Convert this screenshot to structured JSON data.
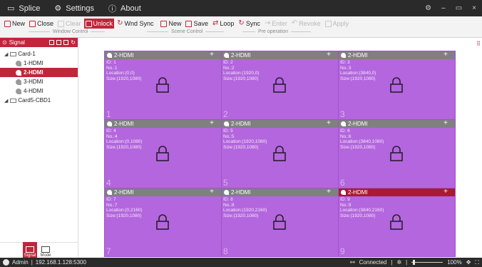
{
  "titlebar": {
    "tabs": [
      {
        "label": "Splice",
        "icon": "window-icon"
      },
      {
        "label": "Settings",
        "icon": "gear-icon"
      },
      {
        "label": "About",
        "icon": "info-icon"
      }
    ],
    "controls": {
      "settings": "⚙",
      "minimize": "–",
      "restore": "▭",
      "close": "×"
    }
  },
  "toolbar": {
    "window_control": {
      "label": "Window Control",
      "buttons": [
        {
          "label": "New",
          "state": "normal"
        },
        {
          "label": "Close",
          "state": "normal"
        },
        {
          "label": "Clear",
          "state": "disabled"
        },
        {
          "label": "Unlock",
          "state": "active"
        },
        {
          "label": "Wnd Sync",
          "state": "normal"
        }
      ]
    },
    "scene_control": {
      "label": "Scene Control",
      "buttons": [
        {
          "label": "New",
          "state": "normal"
        },
        {
          "label": "Save",
          "state": "normal"
        },
        {
          "label": "Loop",
          "state": "normal"
        },
        {
          "label": "Sync",
          "state": "normal"
        }
      ]
    },
    "pre_operation": {
      "label": "Pre operation",
      "buttons": [
        {
          "label": "Enter",
          "state": "disabled"
        },
        {
          "label": "Revoke",
          "state": "disabled"
        },
        {
          "label": "Apply",
          "state": "disabled"
        }
      ]
    }
  },
  "left_panel": {
    "header": "Signal",
    "tree": [
      {
        "label": "Card-1",
        "level": 0,
        "type": "card"
      },
      {
        "label": "1-HDMI",
        "level": 1,
        "type": "hdmi"
      },
      {
        "label": "2-HDMI",
        "level": 1,
        "type": "hdmi",
        "selected": true
      },
      {
        "label": "3-HDMI",
        "level": 1,
        "type": "hdmi"
      },
      {
        "label": "4-HDMI",
        "level": 1,
        "type": "hdmi"
      },
      {
        "label": "Card5-CBD1",
        "level": 0,
        "type": "card"
      }
    ],
    "modes": {
      "signal": "Signal",
      "mode": "Mode"
    }
  },
  "screens": [
    {
      "title": "2-HDMI",
      "id": "ID: 1",
      "no": "No.:1",
      "location": "Location:(0,0)",
      "size": "Size:(1920,1080)",
      "number": "1"
    },
    {
      "title": "2-HDMI",
      "id": "ID: 2",
      "no": "No.:2",
      "location": "Location:(1920,0)",
      "size": "Size:(1920,1080)",
      "number": "2"
    },
    {
      "title": "2-HDMI",
      "id": "ID: 3",
      "no": "No.:3",
      "location": "Location:(3840,0)",
      "size": "Size:(1920,1080)",
      "number": "3"
    },
    {
      "title": "2-HDMI",
      "id": "ID: 4",
      "no": "No.:4",
      "location": "Location:(0,1080)",
      "size": "Size:(1920,1080)",
      "number": "4"
    },
    {
      "title": "2-HDMI",
      "id": "ID: 5",
      "no": "No.:5",
      "location": "Location:(1920,1080)",
      "size": "Size:(1920,1080)",
      "number": "5"
    },
    {
      "title": "2-HDMI",
      "id": "ID: 6",
      "no": "No.:6",
      "location": "Location:(3840,1080)",
      "size": "Size:(1920,1080)",
      "number": "6"
    },
    {
      "title": "2-HDMI",
      "id": "ID: 7",
      "no": "No.:7",
      "location": "Location:(0,2160)",
      "size": "Size:(1920,1080)",
      "number": "7"
    },
    {
      "title": "2-HDMI",
      "id": "ID: 8",
      "no": "No.:8",
      "location": "Location:(1920,2160)",
      "size": "Size:(1920,1080)",
      "number": "8"
    },
    {
      "title": "2-HDMI",
      "id": "ID: 9",
      "no": "No.:9",
      "location": "Location:(3840,2160)",
      "size": "Size:(1920,1080)",
      "number": "9",
      "selected": true
    }
  ],
  "statusbar": {
    "user": "Admin",
    "address": "192.168.1.128:5300",
    "connection": "Connected",
    "zoom": "100%",
    "zoom_level": 1.0
  },
  "colors": {
    "accent": "#c0253a",
    "screen": "#b366dd",
    "titlebar": "#2a2a2a"
  }
}
